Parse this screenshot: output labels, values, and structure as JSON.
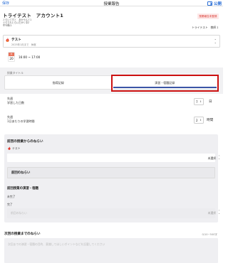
{
  "topbar": {
    "save_label": "保存",
    "title": "授業報告",
    "publish_label": "公開"
  },
  "student": {
    "name": "トライテスト　アカウント1",
    "ruby": "とらいてすと　あかうんと1",
    "ruby2": "ぐらでもとらいだがく中2",
    "grade": "中3新1",
    "status_badge": "授業報告未登録",
    "teacher": "トライテスト　教師１"
  },
  "course": {
    "name": "テスト",
    "date_range": "2025年1月まで　休館"
  },
  "lesson": {
    "weekday": "木",
    "day": "20",
    "time_range": "16:00 ~ 17:00"
  },
  "section_label": "授業タイトル",
  "tabs": [
    {
      "label": "指導記録",
      "active": false
    },
    {
      "label": "演習・宿題記録",
      "active": true
    }
  ],
  "stats": {
    "days_label_line1": "先週",
    "days_label_line2": "学習した日数",
    "days_value": "7",
    "days_unit": "日",
    "hours_label_line1": "先週",
    "hours_label_line2": "1日あたりの学習時間",
    "hours_value": "2",
    "hours_unit": "時間"
  },
  "previous": {
    "aim_title": "前回の授業からのねらい",
    "course_name": "テスト",
    "select_value": "未選択",
    "aim_label": "前回のねらい",
    "practice_title": "前回授業の演習・宿題",
    "incomplete_label": "未完了",
    "complete_label": "完了",
    "aim_placeholder": "前回のねらい",
    "select_value2": "未選択"
  },
  "next": {
    "title": "次回の授業までのねらい",
    "counter": "0/10~500字",
    "placeholder": "次回までの演習・宿題の目的、意識してほしいポイントなどを記載してください"
  },
  "colors": {
    "accent": "#2b6fd6",
    "tab_underline": "#3a55a6",
    "highlight": "#cc1111",
    "badge_text": "#d8342c"
  }
}
